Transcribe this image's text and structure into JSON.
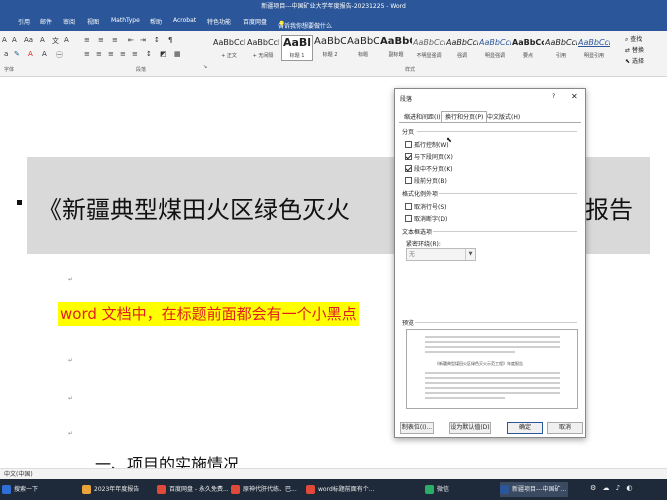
{
  "window": {
    "title": "新疆项目---中国矿业大学年度报告-20231225 - Word"
  },
  "ribbon_tabs": [
    "引用",
    "邮件",
    "审阅",
    "视图",
    "MathType",
    "帮助",
    "Acrobat",
    "特色功能",
    "百度网盘"
  ],
  "tell_me": "告诉我你想要做什么",
  "ribbon": {
    "groups": {
      "font": "字体",
      "paragraph": "段落",
      "styles": "样式"
    },
    "styles": [
      {
        "sample": "AaBbCcDc",
        "name": "+ 正文"
      },
      {
        "sample": "AaBbCcDc",
        "name": "+ 无间隔"
      },
      {
        "sample": "AaBl",
        "name": "标题 1"
      },
      {
        "sample": "AaBbC",
        "name": "标题 2"
      },
      {
        "sample": "AaBbC",
        "name": "标题"
      },
      {
        "sample": "AaBbC",
        "name": "副标题"
      },
      {
        "sample": "AaBbCcD",
        "name": "不明显强调"
      },
      {
        "sample": "AaBbCcD",
        "name": "强调"
      },
      {
        "sample": "AaBbCcD",
        "name": "明显强调"
      },
      {
        "sample": "AaBbCcD",
        "name": "要点"
      },
      {
        "sample": "AaBbCcDc",
        "name": "引用"
      },
      {
        "sample": "AaBbCcDc",
        "name": "明显引用"
      }
    ],
    "editing": {
      "find": "查找",
      "replace": "替换",
      "select": "选择"
    }
  },
  "document": {
    "heading_text": "《新疆典型煤田火区绿色灭火",
    "heading_tail": "报告",
    "highlight_text": "word 文档中，在标题前面都会有一个小黑点",
    "para_mark": "↵",
    "cut_heading": "一、项目的实施情况"
  },
  "dialog": {
    "title": "段落",
    "help": "?",
    "close": "✕",
    "tabs": [
      "缩进和间距(I)",
      "换行和分页(P)",
      "中文版式(H)"
    ],
    "active_tab": 1,
    "pagination": {
      "label": "分页",
      "options": [
        {
          "label": "孤行控制(W)",
          "checked": false
        },
        {
          "label": "与下段同页(X)",
          "checked": true
        },
        {
          "label": "段中不分页(K)",
          "checked": true
        },
        {
          "label": "段前分页(B)",
          "checked": false
        }
      ]
    },
    "format_exceptions": {
      "label": "格式化例外项",
      "options": [
        {
          "label": "取消行号(S)",
          "checked": false
        },
        {
          "label": "取消断字(D)",
          "checked": false
        }
      ]
    },
    "textbox": {
      "label": "文本框选项",
      "wrap_label": "紧密环绕(R):",
      "wrap_value": "无"
    },
    "preview_label": "预览",
    "preview_text": "《新疆典型煤田火区绿色灭火示范工程》年度报告",
    "buttons": {
      "tabs": "制表位(I)...",
      "default": "设为默认值(D)",
      "ok": "确定",
      "cancel": "取消"
    }
  },
  "statusbar": {
    "language": "中文(中国)"
  },
  "taskbar": {
    "items": [
      {
        "label": "搜索一下",
        "color": "#2d6fd6"
      },
      {
        "label": "2023年年度报告",
        "color": "#e8a33b"
      },
      {
        "label": "百度网盘 - 永久免费...",
        "color": "#e04a3a"
      },
      {
        "label": "原神代肝代练、巴...",
        "color": "#e04a3a"
      },
      {
        "label": "word标题前面有个...",
        "color": "#e04a3a"
      },
      {
        "label": "微信",
        "color": "#2aae67"
      },
      {
        "label": "新疆项目---中国矿...",
        "color": "#2b579a"
      }
    ]
  }
}
